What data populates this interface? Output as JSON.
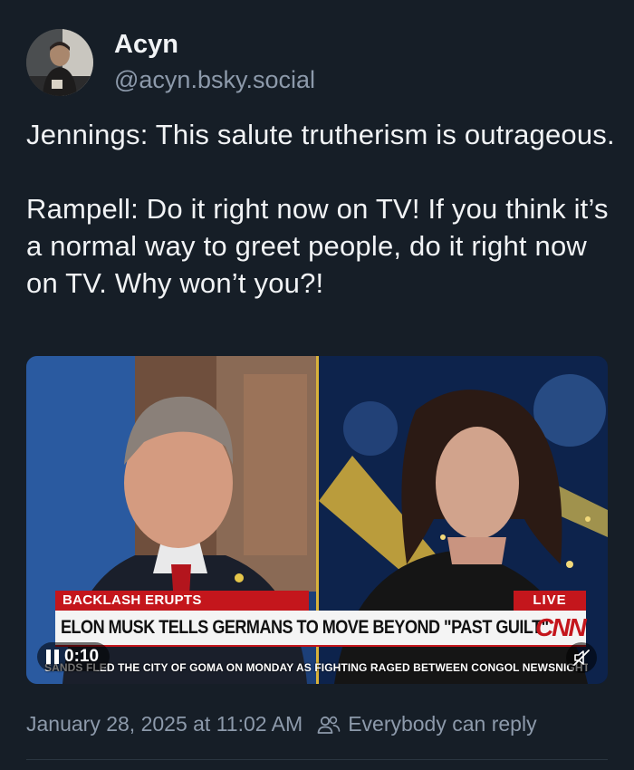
{
  "author": {
    "display_name": "Acyn",
    "handle": "@acyn.bsky.social"
  },
  "post": {
    "paragraphs": [
      "Jennings: This salute trutherism is outrageous.",
      "Rampell: Do it right now on TV! If you think it’s a normal way to greet people, do it right now on TV. Why won’t you?!"
    ]
  },
  "video": {
    "lower_third_tag": "BACKLASH ERUPTS",
    "live_tag": "LIVE",
    "headline": "ELON MUSK TELLS GERMANS TO MOVE BEYOND \"PAST GUILT\"",
    "network_logo": "CNN",
    "ticker": "SANDS FLED THE CITY OF GOMA ON MONDAY AS FIGHTING RAGED BETWEEN CONGOL NEWSNIGHT",
    "elapsed_time": "0:10",
    "play_state_icon": "pause-icon",
    "mute_icon": "muted-speaker-icon"
  },
  "footer": {
    "timestamp": "January 28, 2025 at 11:02 AM",
    "reply_setting": "Everybody can reply",
    "reply_icon": "people-icon"
  },
  "colors": {
    "background": "#161e27",
    "primary_text": "#f1f3f5",
    "secondary_text": "#8d9aab",
    "cnn_red": "#c4161c"
  }
}
